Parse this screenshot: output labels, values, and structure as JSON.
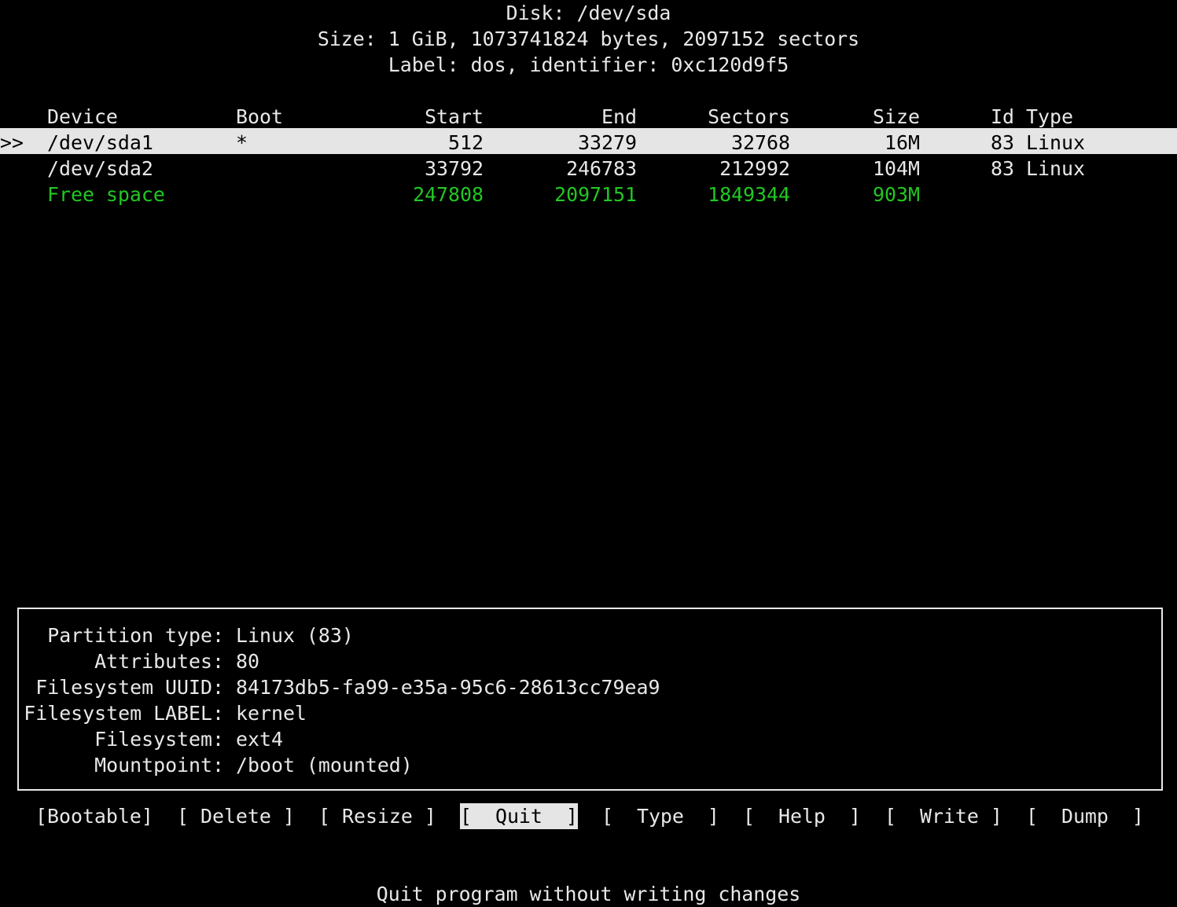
{
  "disk": {
    "title": "Disk: /dev/sda",
    "size": "Size: 1 GiB, 1073741824 bytes, 2097152 sectors",
    "label": "Label: dos, identifier: 0xc120d9f5"
  },
  "table": {
    "headers": {
      "device": "Device",
      "boot": "Boot",
      "start": "Start",
      "end": "End",
      "sectors": "Sectors",
      "size": "Size",
      "id": "Id",
      "type": "Type"
    },
    "cursor": ">>",
    "rows": [
      {
        "device": "/dev/sda1",
        "boot": "*",
        "start": "512",
        "end": "33279",
        "sectors": "32768",
        "size": "16M",
        "id": "83",
        "type": "Linux",
        "selected": true
      },
      {
        "device": "/dev/sda2",
        "boot": "",
        "start": "33792",
        "end": "246783",
        "sectors": "212992",
        "size": "104M",
        "id": "83",
        "type": "Linux"
      },
      {
        "device": "Free space",
        "boot": "",
        "start": "247808",
        "end": "2097151",
        "sectors": "1849344",
        "size": "903M",
        "id": "",
        "type": "",
        "color": "#22c722"
      }
    ]
  },
  "details": [
    {
      "label": "Partition type:",
      "value": "Linux (83)"
    },
    {
      "label": "Attributes:",
      "value": "80"
    },
    {
      "label": "Filesystem UUID:",
      "value": "84173db5-fa99-e35a-95c6-28613cc79ea9"
    },
    {
      "label": "Filesystem LABEL:",
      "value": "kernel"
    },
    {
      "label": "Filesystem:",
      "value": "ext4"
    },
    {
      "label": "Mountpoint:",
      "value": "/boot (mounted)"
    }
  ],
  "menu": [
    {
      "label": "[Bootable]"
    },
    {
      "label": "[ Delete ]"
    },
    {
      "label": "[ Resize ]"
    },
    {
      "label": "[  Quit  ]",
      "active": true
    },
    {
      "label": "[  Type  ]"
    },
    {
      "label": "[  Help  ]"
    },
    {
      "label": "[  Write ]"
    },
    {
      "label": "[  Dump  ]"
    }
  ],
  "status": "Quit program without writing changes",
  "colors": {
    "background": "#000000",
    "text": "#e8e8e8",
    "highlight": "#e5e5e5",
    "free_space": "#22c722"
  }
}
